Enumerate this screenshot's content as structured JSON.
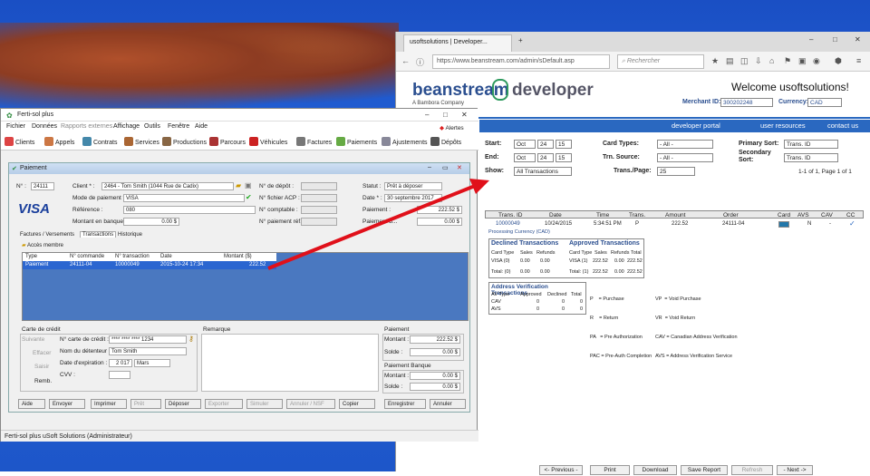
{
  "browser": {
    "tab_title": "usoftsolutions | Developer...",
    "url": "https://www.beanstream.com/admin/sDefault.asp",
    "search_placeholder": "Rechercher",
    "logo_brand": "beanstream",
    "logo_developer": "developer",
    "logo_sub": "A Bambora Company",
    "welcome": "Welcome usoftsolutions!",
    "merchant_label": "Merchant ID:",
    "merchant_value": "300202248",
    "currency_label": "Currency:",
    "currency_value": "CAD",
    "menu": [
      "developer portal",
      "user resources",
      "contact us"
    ],
    "filters": {
      "start_label": "Start:",
      "start": [
        "Oct",
        "24",
        "15"
      ],
      "end_label": "End:",
      "end": [
        "Oct",
        "24",
        "15"
      ],
      "show_label": "Show:",
      "show_value": "All Transactions",
      "card_types_label": "Card Types:",
      "card_types_value": "- All -",
      "trn_source_label": "Trn. Source:",
      "trn_source_value": "- All -",
      "trans_page_label": "Trans./Page:",
      "trans_page_value": "25",
      "primary_sort_label": "Primary Sort:",
      "primary_sort_value": "Trans. ID",
      "secondary_sort_label": "Secondary Sort:",
      "secondary_sort_value": "Trans. ID",
      "paging": "1-1 of 1, Page 1 of 1"
    },
    "results": {
      "headers": [
        "Trans. ID",
        "Date",
        "Time",
        "Trans.",
        "Amount",
        "Order",
        "Card",
        "AVS",
        "CAV",
        "CC"
      ],
      "row": [
        "10000049",
        "10/24/2015",
        "5:34:51 PM",
        "P",
        "222.52",
        "24111-04",
        "",
        "N",
        "-",
        "✓"
      ],
      "currency_note": "Processing Currency (CAD)"
    },
    "declined": {
      "title": "Declined Transactions",
      "headers": [
        "Card Type",
        "Sales",
        "Refunds"
      ],
      "rows": [
        [
          "VISA (0)",
          "0.00",
          "0.00"
        ],
        [
          "Total: (0)",
          "0.00",
          "0.00"
        ]
      ]
    },
    "approved": {
      "title": "Approved Transactions",
      "headers": [
        "Card Type",
        "Sales",
        "Refunds",
        "Total"
      ],
      "rows": [
        [
          "VISA (1)",
          "222.52",
          "0.00",
          "222.52"
        ],
        [
          "Total: (1)",
          "222.52",
          "0.00",
          "222.52"
        ]
      ]
    },
    "avs": {
      "title": "Address Verification Transactions",
      "headers": [
        "AV Type",
        "Approved",
        "Declined",
        "Total"
      ],
      "rows": [
        [
          "CAV",
          "0",
          "0",
          "0"
        ],
        [
          "AVS",
          "0",
          "0",
          "0"
        ]
      ]
    },
    "legend_left": [
      "P    = Purchase",
      "R    = Return",
      "PA   = Pre Authorization",
      "PAC = Pre-Auth Completion"
    ],
    "legend_right": [
      "VP  = Void Purchase",
      "VR  = Void Return",
      "CAV = Canadian Address Verification",
      "AVS = Address Verification Service"
    ],
    "footer_buttons": [
      "<- Previous -",
      "Print",
      "Download",
      "Save Report",
      "Refresh",
      "- Next ->"
    ]
  },
  "app": {
    "title": "Ferti-sol plus",
    "menu": [
      "Fichier",
      "Données",
      "Rapports externes",
      "Affichage",
      "Outils",
      "Fenêtre",
      "Aide"
    ],
    "toolbar": [
      "Clients",
      "Appels",
      "Contrats",
      "Services",
      "Productions",
      "Parcours",
      "Véhicules",
      "Factures",
      "Paiements",
      "Ajustements",
      "Dépôts"
    ],
    "alerts": "Alertes",
    "window_title": "Paiement",
    "fields": {
      "no_label": "N° :",
      "no_value": "24111",
      "client_label": "Client * :",
      "client_value": "2464 - Tom Smith  (1044 Rue de Cadix)",
      "depot_label": "N° de dépôt :",
      "statut_label": "Statut :",
      "statut_value": "Prêt à déposer",
      "mode_label": "Mode de paiement * :",
      "mode_value": "VISA",
      "acp_label": "N° fichier ACP :",
      "date_label": "Date * :",
      "date_value": "30 septembre 2017",
      "ref_label": "Référence :",
      "ref_value": "080",
      "comptable_label": "N° comptable :",
      "paiement_label": "Paiement :",
      "paiement_value": "222.52 $",
      "banque_label": "Montant en banque :",
      "banque_value": "0.00 $",
      "paiement_ref_label": "N° paiement réf. :",
      "paiement_b_label": "Paiement b...",
      "paiement_b_value": "0.00 $",
      "visa_logo": "VISA"
    },
    "tabs": [
      "Factures / Versements",
      "Transactions",
      "Historique"
    ],
    "acces_membre": "Accès membre",
    "grid": {
      "headers": [
        "Type",
        "N° commande",
        "N° transaction",
        "Date",
        "Montant ($)"
      ],
      "row": [
        "Paiement",
        "24111-04",
        "10000049",
        "2015-10-24 17:34",
        "222.52"
      ]
    },
    "card": {
      "section": "Carte de crédit",
      "suivante": "Suivante",
      "effacer": "Effacer",
      "saisir": "Saisir",
      "remb": "Remb.",
      "num_label": "N° carte de crédit :",
      "num_value": "**** **** **** 1234",
      "holder_label": "Nom du détenteur :",
      "holder_value": "Tom Smith",
      "exp_label": "Date d'expiration :",
      "exp_year": "2 017",
      "exp_month": "Mars",
      "cvv_label": "CVV :"
    },
    "remarque": "Remarque",
    "paiement_box": {
      "title": "Paiement",
      "montant_label": "Montant :",
      "montant_value": "222.52 $",
      "solde_label": "Solde :",
      "solde_value": "0.00 $"
    },
    "banque_box": {
      "title": "Paiement Banque",
      "montant_label": "Montant :",
      "montant_value": "0.00 $",
      "solde_label": "Solde :",
      "solde_value": "0.00 $"
    },
    "buttons": [
      "Aide",
      "Envoyer",
      "Imprimer",
      "Prêt",
      "Déposer",
      "Exporter",
      "Simuler",
      "Annuler / NSF",
      "Copier",
      "Enregistrer",
      "Annuler"
    ],
    "status": "Ferti-sol plus   uSoft Solutions (Administrateur)"
  },
  "colors": {
    "accent_blue": "#2a68c0",
    "arrow": "#e0101a",
    "grid_select": "#2b66d0"
  }
}
